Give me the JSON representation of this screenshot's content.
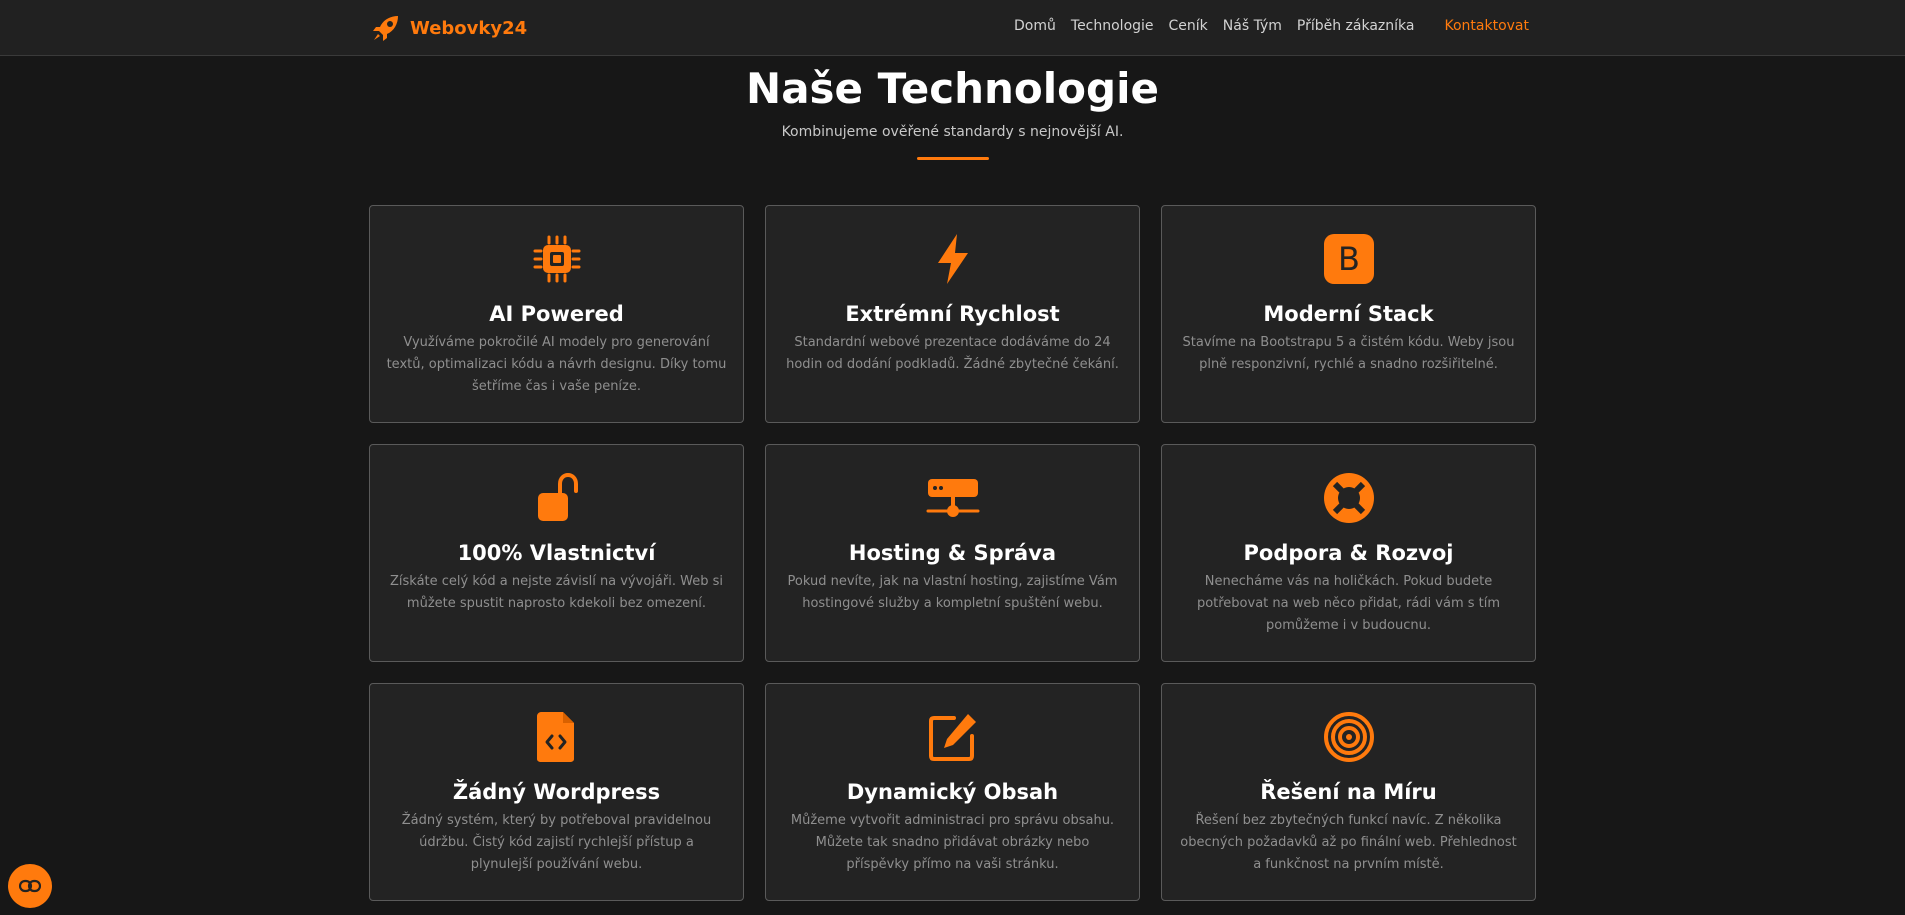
{
  "nav": {
    "brand": "Webovky24",
    "links": [
      "Domů",
      "Technologie",
      "Ceník",
      "Náš Tým",
      "Příběh zákazníka"
    ],
    "contact": "Kontaktovat"
  },
  "hero": {
    "title": "Naše Technologie",
    "subtitle": "Kombinujeme ověřené standardy s nejnovější AI."
  },
  "cards": [
    {
      "icon": "cpu-icon",
      "title": "AI Powered",
      "text": "Využíváme pokročilé AI modely pro generování textů, optimalizaci kódu a návrh designu. Díky tomu šetříme čas i vaše peníze."
    },
    {
      "icon": "lightning-icon",
      "title": "Extrémní Rychlost",
      "text": "Standardní webové prezentace dodáváme do 24 hodin od dodání podkladů. Žádné zbytečné čekání."
    },
    {
      "icon": "bootstrap-icon",
      "title": "Moderní Stack",
      "text": "Stavíme na Bootstrapu 5 a čistém kódu. Weby jsou plně responzivní, rychlé a snadno rozšiřitelné."
    },
    {
      "icon": "unlock-icon",
      "title": "100% Vlastnictví",
      "text": "Získáte celý kód a nejste závislí na vývojáři. Web si můžete spustit naprosto kdekoli bez omezení."
    },
    {
      "icon": "server-icon",
      "title": "Hosting & Správa",
      "text": "Pokud nevíte, jak na vlastní hosting, zajistíme Vám hostingové služby a kompletní spuštění webu."
    },
    {
      "icon": "lifebuoy-icon",
      "title": "Podpora & Rozvoj",
      "text": "Nenecháme vás na holičkách. Pokud budete potřebovat na web něco přidat, rádi vám s tím pomůžeme i v budoucnu."
    },
    {
      "icon": "file-code-icon",
      "title": "Žádný Wordpress",
      "text": "Žádný systém, který by potřeboval pravidelnou údržbu. Čistý kód zajistí rychlejší přístup a plynulejší používání webu."
    },
    {
      "icon": "edit-icon",
      "title": "Dynamický Obsah",
      "text": "Můžeme vytvořit administraci pro správu obsahu. Můžete tak snadno přidávat obrázky nebo příspěvky přímo na vaši stránku."
    },
    {
      "icon": "target-icon",
      "title": "Řešení na Míru",
      "text": "Řešení bez zbytečných funkcí navíc. Z několika obecných požadavků až po finální web. Přehlednost a funkčnost na prvním místě."
    }
  ],
  "floating_button": {
    "icon": "link-icon"
  },
  "colors": {
    "accent": "#ff7a0d",
    "background": "#171717",
    "card": "#232323",
    "navbar": "#212121"
  }
}
